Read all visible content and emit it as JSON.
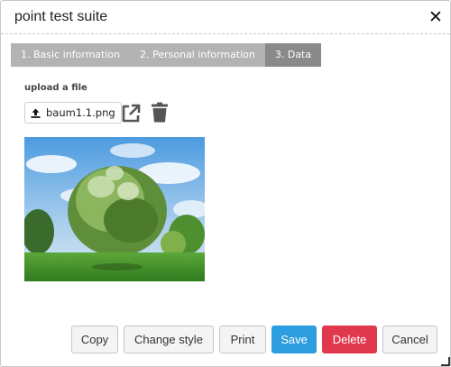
{
  "dialog": {
    "title": "point test suite",
    "close_symbol": "✕"
  },
  "steps": [
    {
      "label": "1. Basic information",
      "active": false
    },
    {
      "label": "2. Personal information",
      "active": false
    },
    {
      "label": "3. Data",
      "active": true
    }
  ],
  "upload": {
    "label": "upload a file",
    "file_name": "baum1.1.png",
    "icons": [
      "upload-icon",
      "external-link-icon",
      "trash-icon"
    ]
  },
  "image": {
    "subject": "tree-photo"
  },
  "footer": {
    "copy": "Copy",
    "change_style": "Change style",
    "print": "Print",
    "save": "Save",
    "delete": "Delete",
    "cancel": "Cancel"
  },
  "colors": {
    "save": "#2c9ee0",
    "delete": "#e0394d",
    "step_inactive": "#b3b3b3",
    "step_active": "#8a8a8a"
  }
}
